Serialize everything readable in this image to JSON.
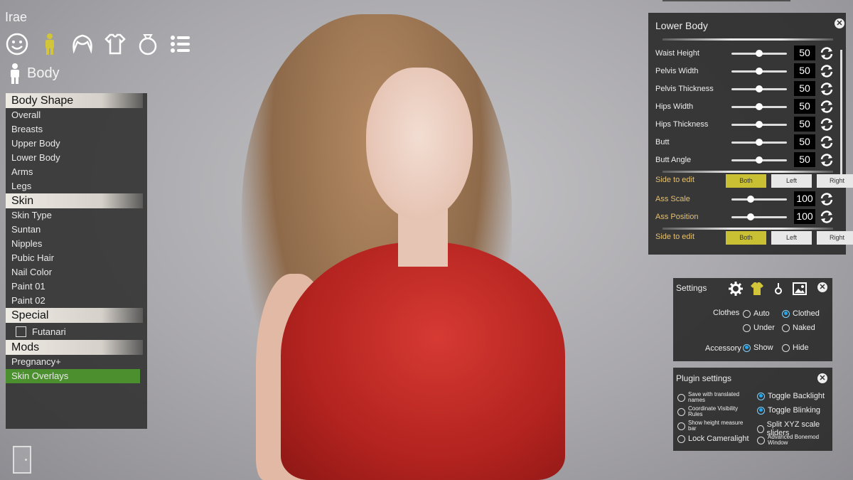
{
  "character_name": "Irae",
  "category_icons": [
    "face-icon",
    "body-icon",
    "hair-icon",
    "clothes-icon",
    "accessory-icon",
    "list-icon"
  ],
  "section_title": "Body",
  "left_menu": {
    "groups": [
      {
        "title": "Body Shape",
        "items": [
          "Overall",
          "Breasts",
          "Upper Body",
          "Lower Body",
          "Arms",
          "Legs"
        ]
      },
      {
        "title": "Skin",
        "items": [
          "Skin Type",
          "Suntan",
          "Nipples",
          "Pubic Hair",
          "Nail Color",
          "Paint 01",
          "Paint 02"
        ]
      },
      {
        "title": "Special",
        "checkbox": "Futanari"
      },
      {
        "title": "Mods",
        "items": [
          "Pregnancy+",
          "Skin Overlays"
        ]
      }
    ],
    "selected": "Skin Overlays"
  },
  "lower_body": {
    "title": "Lower Body",
    "sliders": [
      {
        "label": "Waist Height",
        "value": "50"
      },
      {
        "label": "Pelvis Width",
        "value": "50"
      },
      {
        "label": "Pelvis Thickness",
        "value": "50"
      },
      {
        "label": "Hips Width",
        "value": "50"
      },
      {
        "label": "Hips Thickness",
        "value": "50"
      },
      {
        "label": "Butt",
        "value": "50"
      },
      {
        "label": "Butt Angle",
        "value": "50"
      }
    ],
    "side_label": "Side to edit",
    "side_options": [
      "Both",
      "Left",
      "Right"
    ],
    "side_selected": "Both",
    "ass_sliders": [
      {
        "label": "Ass Scale",
        "value": "100"
      },
      {
        "label": "Ass Position",
        "value": "100"
      }
    ]
  },
  "settings": {
    "title": "Settings",
    "clothes_label": "Clothes",
    "clothes_options": [
      "Auto",
      "Clothed",
      "Under",
      "Naked"
    ],
    "clothes_selected": "Clothed",
    "accessory_label": "Accessory",
    "accessory_options": [
      "Show",
      "Hide"
    ],
    "accessory_selected": "Show"
  },
  "plugin_settings": {
    "title": "Plugin settings",
    "left_options": [
      {
        "label_lines": [
          "Save with translated",
          "names"
        ],
        "on": false
      },
      {
        "label_lines": [
          "Coordinate Visibility",
          "Rules"
        ],
        "on": false
      },
      {
        "label_lines": [
          "Show height measure",
          "bar"
        ],
        "on": false
      },
      {
        "label_lines": [
          "Lock Cameralight"
        ],
        "on": false
      }
    ],
    "right_options": [
      {
        "label_lines": [
          "Toggle Backlight"
        ],
        "on": true
      },
      {
        "label_lines": [
          "Toggle Blinking"
        ],
        "on": true
      },
      {
        "label_lines": [
          "Split XYZ scale sliders"
        ],
        "on": false
      },
      {
        "label_lines": [
          "Advanced Bonemod",
          "Window"
        ],
        "on": false
      }
    ]
  },
  "colors": {
    "accent_yellow": "#c9c133",
    "selected_green": "#4b8f2e",
    "radio_blue": "#1fa8ef",
    "side_label_orange": "#e4c070"
  }
}
